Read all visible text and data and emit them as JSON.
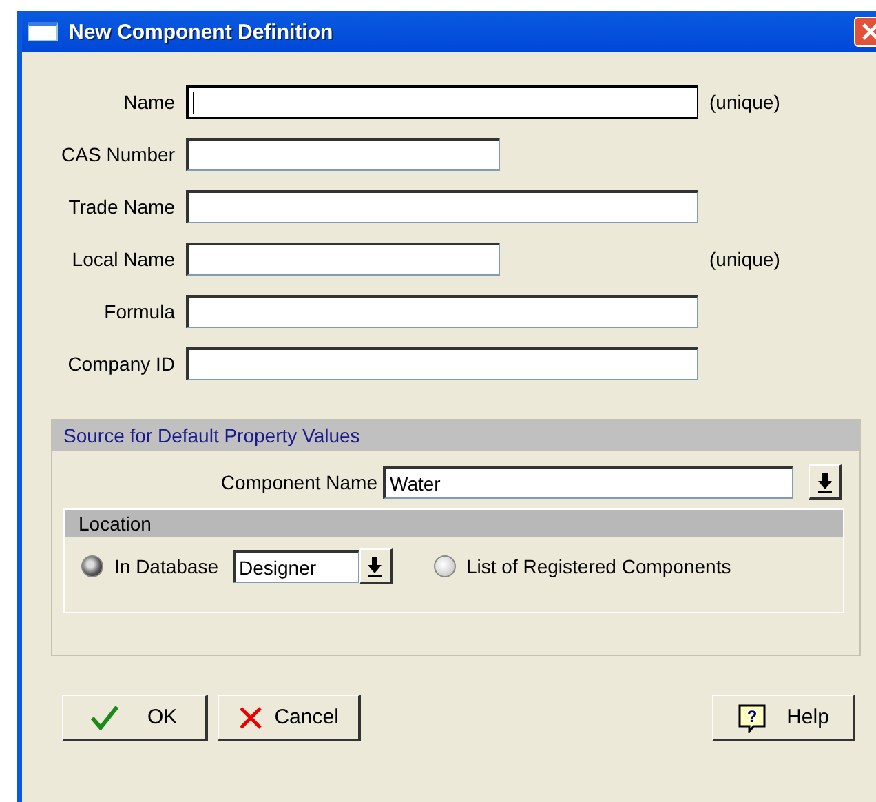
{
  "window": {
    "title": "New Component Definition"
  },
  "fields": [
    {
      "label": "Name",
      "kind": "long",
      "focused": true,
      "note": "(unique)"
    },
    {
      "label": "CAS Number",
      "kind": "short",
      "focused": false
    },
    {
      "label": "Trade Name",
      "kind": "long",
      "focused": false
    },
    {
      "label": "Local Name",
      "kind": "short",
      "focused": false,
      "note": "(unique)"
    },
    {
      "label": "Formula",
      "kind": "long",
      "focused": false
    },
    {
      "label": "Company ID",
      "kind": "long",
      "focused": false
    }
  ],
  "source": {
    "title": "Source for Default Property Values",
    "component_label": "Component Name",
    "component_value": "Water",
    "location": {
      "title": "Location",
      "options": [
        {
          "label": "In Database",
          "selected": true,
          "value": "Designer"
        },
        {
          "label": "List of Registered Components",
          "selected": false
        }
      ]
    }
  },
  "buttons": [
    {
      "label": "OK",
      "kind": "ok"
    },
    {
      "label": "Cancel",
      "kind": "cancel"
    },
    {
      "label": "Help",
      "kind": "help",
      "icon_text": "?"
    }
  ]
}
